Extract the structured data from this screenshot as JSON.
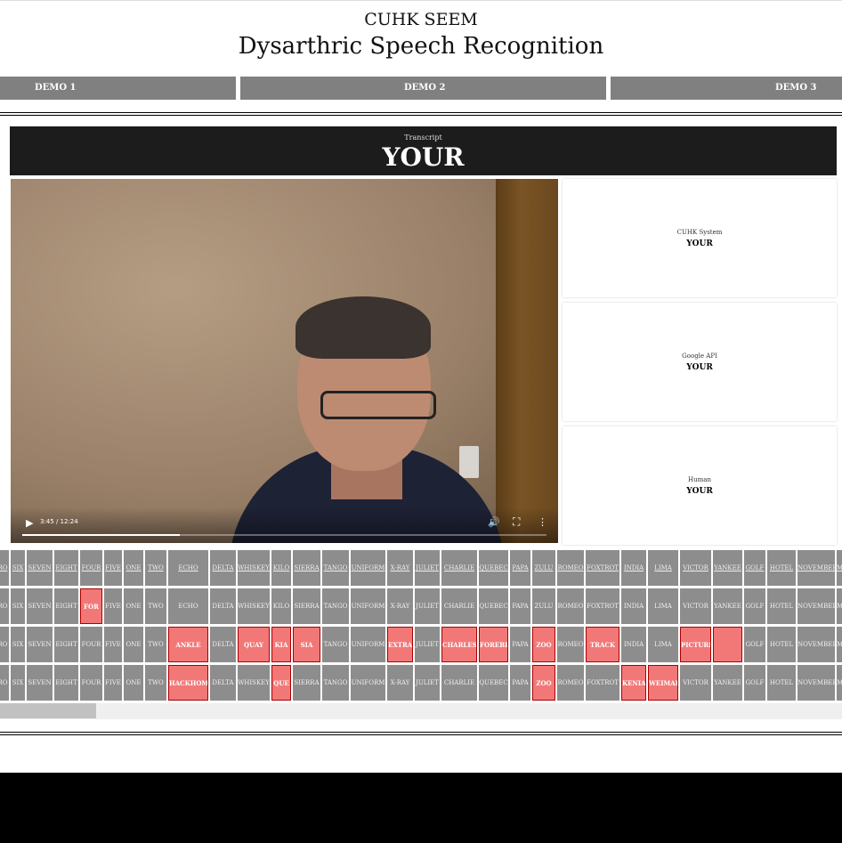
{
  "header": {
    "site_title": "CUHK SEEM",
    "page_title": "Dysarthric Speech Recognition"
  },
  "tabs": [
    "DEMO 1",
    "DEMO 2",
    "DEMO 3"
  ],
  "transcript": {
    "label": "Transcript",
    "word": "YOUR"
  },
  "video": {
    "time": "3:45 / 12:24",
    "progress": 0.3
  },
  "results": [
    {
      "label": "CUHK System",
      "value": "YOUR"
    },
    {
      "label": "Google API",
      "value": "YOUR"
    },
    {
      "label": "Human",
      "value": "YOUR"
    }
  ],
  "grid": {
    "rows": [
      [
        "ZERO",
        "SIX",
        "SEVEN",
        "EIGHT",
        "FOUR",
        "FIVE",
        "ONE",
        "TWO",
        "ECHO",
        "DELTA",
        "WHISKEY",
        "KILO",
        "SIERRA",
        "TANGO",
        "UNIFORM",
        "X-RAY",
        "JULIET",
        "CHARLIE",
        "QUEBEC",
        "PAPA",
        "ZULU",
        "ROMEO",
        "FOXTROT",
        "INDIA",
        "LIMA",
        "VICTOR",
        "YANKEE",
        "GOLF",
        "HOTEL",
        "NOVEMBER",
        "MIKE"
      ],
      [
        "ZERO",
        "SIX",
        "SEVEN",
        "EIGHT",
        "FOR",
        "FIVE",
        "ONE",
        "TWO",
        "ECHO",
        "DELTA",
        "WHISKEY",
        "KILO",
        "SIERRA",
        "TANGO",
        "UNIFORM",
        "X-RAY",
        "JULIET",
        "CHARLIE",
        "QUEBEC",
        "PAPA",
        "ZULU",
        "ROMEO",
        "FOXTROT",
        "INDIA",
        "LIMA",
        "VICTOR",
        "YANKEE",
        "GOLF",
        "HOTEL",
        "NOVEMBER",
        "MIKE"
      ],
      [
        "ZERO",
        "SIX",
        "SEVEN",
        "EIGHT",
        "FOUR",
        "FIVE",
        "ONE",
        "TWO",
        "ANKLE",
        "DELTA",
        "QUAY",
        "KIA",
        "SIA",
        "TANGO",
        "UNIFORM",
        "EXTRA",
        "JULIET",
        "CHARLES",
        "FOREBET",
        "PAPA",
        "ZOO",
        "ROMEO",
        "TRACK",
        "INDIA",
        "LIMA",
        "PICTURE",
        "",
        "GOLF",
        "HOTEL",
        "NOVEMBER",
        "MIKE"
      ],
      [
        "ZERO",
        "SIX",
        "SEVEN",
        "EIGHT",
        "FOUR",
        "FIVE",
        "ONE",
        "TWO",
        "HACKHOME",
        "DELTA",
        "WHISKEY",
        "QUE",
        "SIERRA",
        "TANGO",
        "UNIFORM",
        "X-RAY",
        "JULIET",
        "CHARLIE",
        "QUEBEC",
        "PAPA",
        "ZOO",
        "ROMEO",
        "FOXTROT",
        "KENIA",
        "WEIMAR",
        "VICTOR",
        "YANKEE",
        "GOLF",
        "HOTEL",
        "NOVEMBER",
        "MIKE"
      ]
    ],
    "highlights": [
      [],
      [
        4
      ],
      [
        8,
        10,
        11,
        12,
        15,
        17,
        18,
        20,
        22,
        25,
        26
      ],
      [
        8,
        11,
        20,
        23,
        24
      ]
    ]
  },
  "colors": {
    "cell": "#8d8d8d",
    "highlight": "#f27878",
    "bar": "#1c1c1c"
  }
}
